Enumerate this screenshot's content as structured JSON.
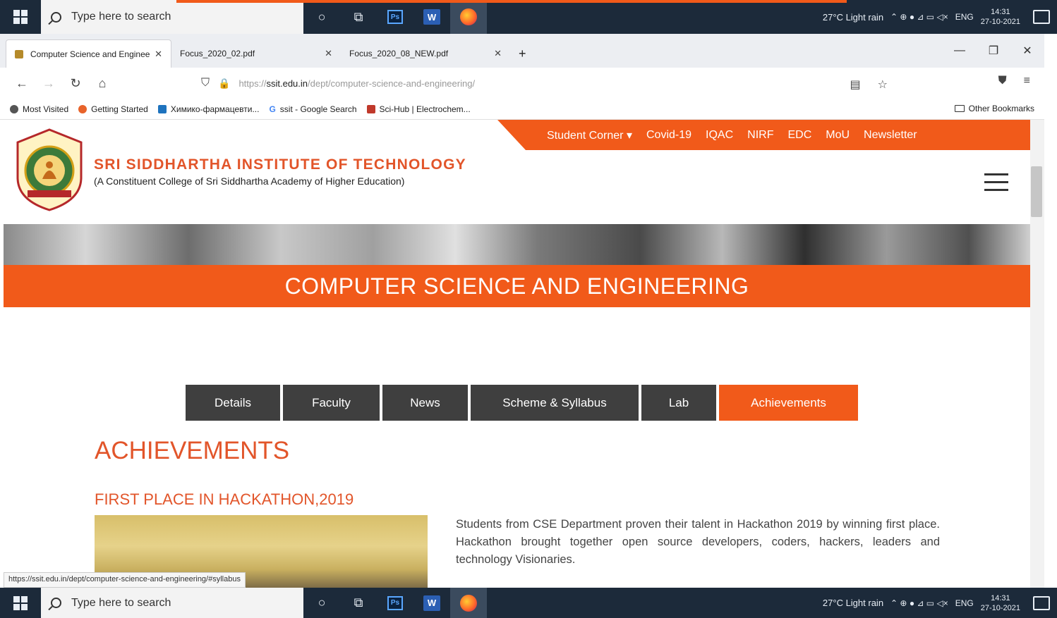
{
  "taskbar": {
    "search_placeholder": "Type here to search",
    "weather": "27°C  Light rain",
    "lang": "ENG",
    "time": "14:31",
    "date": "27-10-2021",
    "apps": [
      "cortana-icon",
      "task-view-icon",
      "photoshop-icon",
      "word-icon",
      "firefox-icon"
    ]
  },
  "browser": {
    "tabs": [
      {
        "label": "Computer Science and Enginee",
        "active": true
      },
      {
        "label": "Focus_2020_02.pdf",
        "active": false
      },
      {
        "label": "Focus_2020_08_NEW.pdf",
        "active": false
      }
    ],
    "url_prefix": "https://",
    "url_domain": "ssit.edu.in",
    "url_path": "/dept/computer-science-and-engineering/",
    "bookmarks": [
      {
        "label": "Most Visited",
        "color": "#555555"
      },
      {
        "label": "Getting Started",
        "color": "#e8632a"
      },
      {
        "label": "Химико-фармацевти...",
        "color": "#1e73be"
      },
      {
        "label": "ssit - Google Search",
        "color": "#4285f4"
      },
      {
        "label": "Sci-Hub | Electrochem...",
        "color": "#c0392b"
      }
    ],
    "other_bookmarks": "Other Bookmarks"
  },
  "site": {
    "topnav": [
      "Student Corner ▾",
      "Covid-19",
      "IQAC",
      "NIRF",
      "EDC",
      "MoU",
      "Newsletter"
    ],
    "inst_name": "SRI SIDDHARTHA INSTITUTE OF TECHNOLOGY",
    "inst_sub": "(A Constituent College of Sri Siddhartha Academy of Higher Education)",
    "banner_title": "COMPUTER SCIENCE AND ENGINEERING",
    "tabs": [
      {
        "label": "Details",
        "width": 134
      },
      {
        "label": "Faculty",
        "width": 137
      },
      {
        "label": "News",
        "width": 121
      },
      {
        "label": "Scheme & Syllabus",
        "width": 238
      },
      {
        "label": "Lab",
        "width": 106
      },
      {
        "label": "Achievements",
        "width": 197,
        "active": true
      }
    ],
    "section_title": "ACHIEVEMENTS",
    "achievement_title": "FIRST PLACE IN HACKATHON,2019",
    "achievement_text": "Students from CSE Department proven their talent in Hackathon 2019 by winning first place. Hackathon brought together open source developers, coders, hackers, leaders and technology Visionaries.",
    "accent": "#f15a1a"
  },
  "status_url": "https://ssit.edu.in/dept/computer-science-and-engineering/#syllabus"
}
